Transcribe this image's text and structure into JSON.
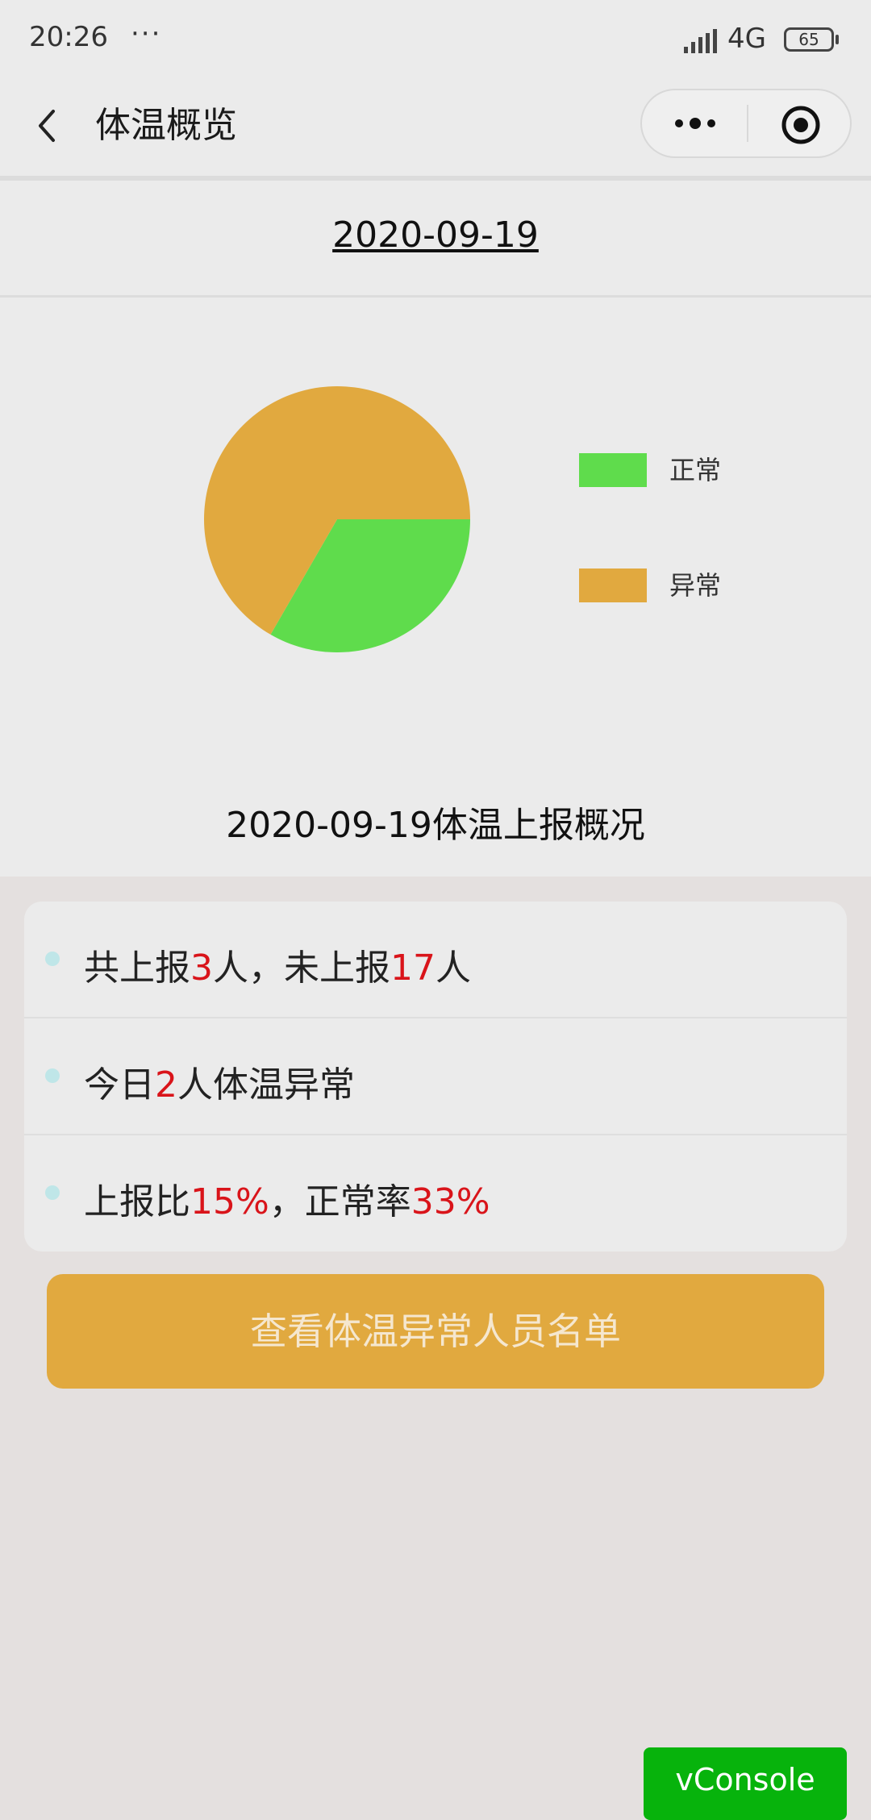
{
  "status_bar": {
    "time": "20:26",
    "dots": "···",
    "network": "4G",
    "battery": "65"
  },
  "nav": {
    "title": "体温概览"
  },
  "date_header": "2020-09-19",
  "chart_data": {
    "type": "pie",
    "title": "2020-09-19体温上报概况",
    "categories": [
      "正常",
      "异常"
    ],
    "values": [
      1,
      2
    ],
    "colors": [
      "#5fdc4c",
      "#e1a93f"
    ],
    "legend_position": "right"
  },
  "summary": {
    "row1": {
      "p1": "共上报",
      "reported": "3",
      "p2": "人，未上报",
      "unreported": "17",
      "p3": "人"
    },
    "row2": {
      "p1": "今日",
      "abnormal": "2",
      "p2": "人体温异常"
    },
    "row3": {
      "p1": "上报比",
      "report_ratio": "15%",
      "p2": "，正常率",
      "normal_rate": "33%"
    }
  },
  "button_label": "查看体温异常人员名单",
  "vconsole_label": "vConsole",
  "colors": {
    "accent": "#e1a93f",
    "normal": "#5fdc4c",
    "highlight": "#d9141a",
    "vconsole": "#07b30c"
  }
}
